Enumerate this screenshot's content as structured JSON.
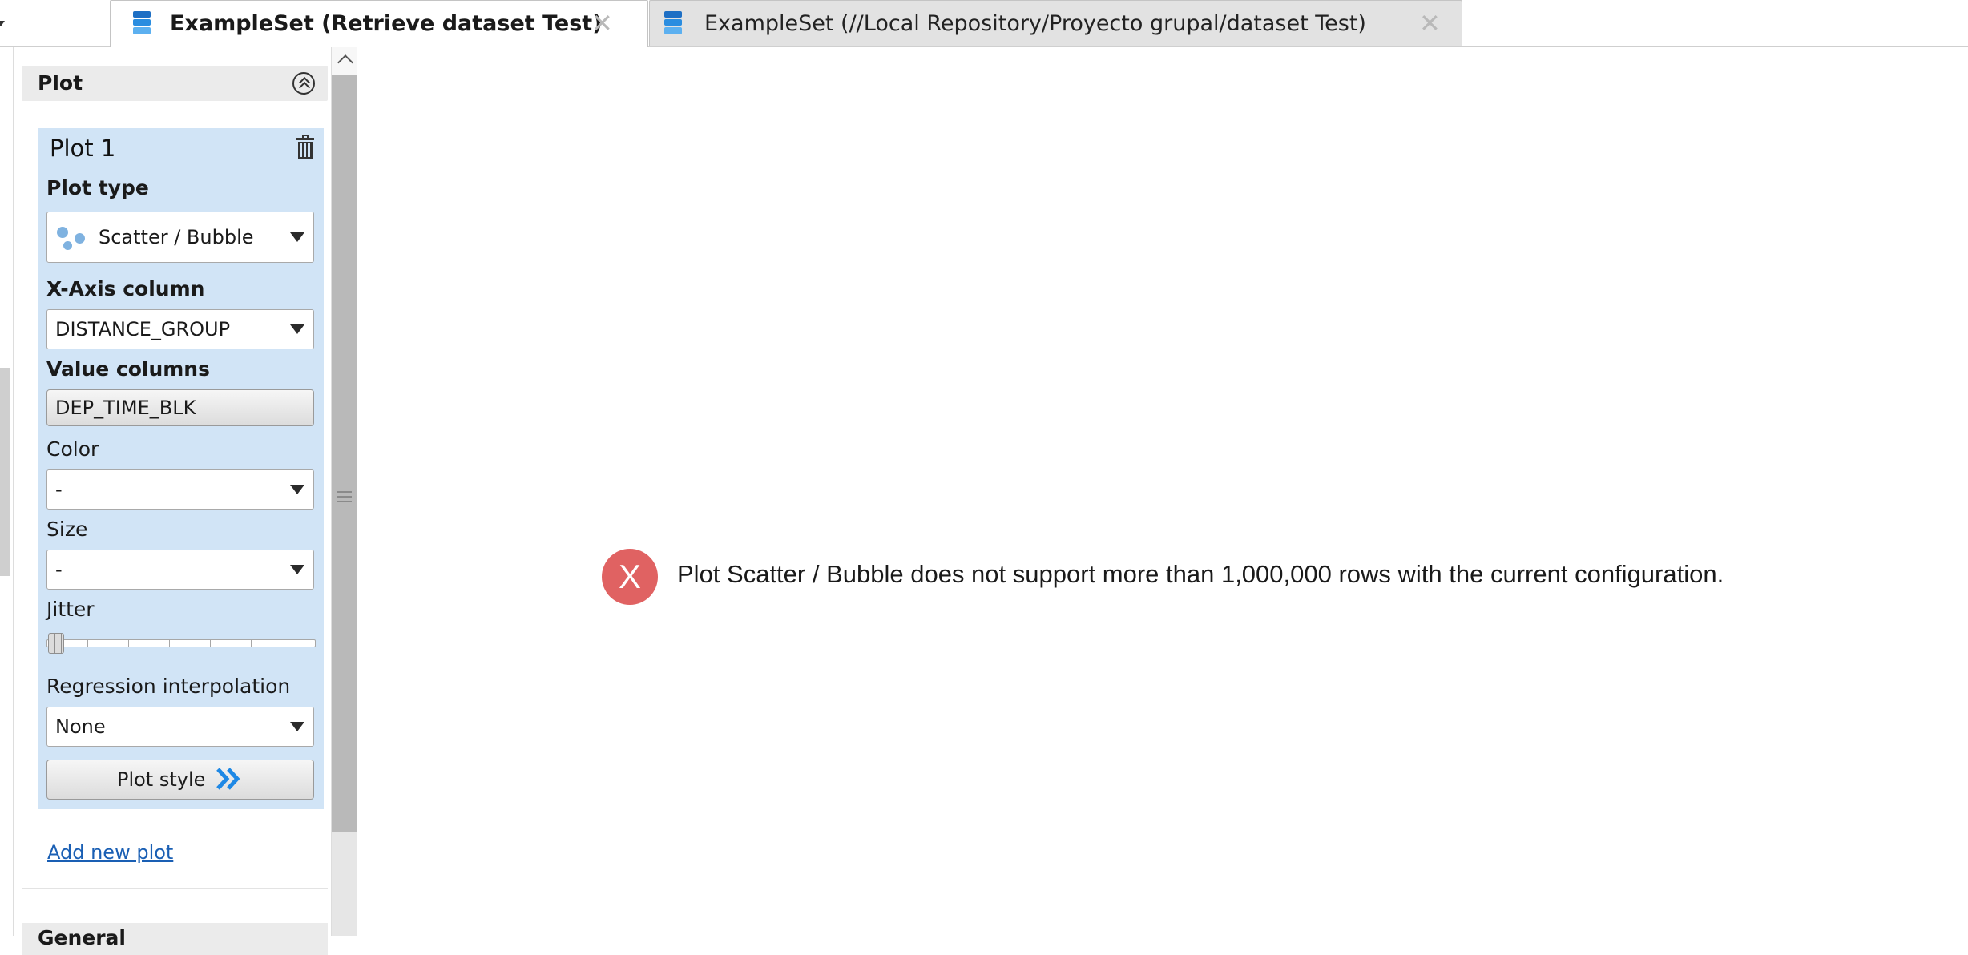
{
  "tabs": [
    {
      "label": "ExampleSet (Retrieve dataset Test)",
      "active": true,
      "icon": "dataset-icon",
      "close": "✕"
    },
    {
      "label": "ExampleSet (//Local Repository/Proyecto grupal/dataset Test)",
      "active": false,
      "icon": "dataset-icon",
      "close": "✕"
    }
  ],
  "panel": {
    "section_title": "Plot",
    "plot": {
      "title": "Plot 1",
      "plot_type_label": "Plot type",
      "plot_type_value": "Scatter / Bubble",
      "x_axis_label": "X-Axis column",
      "x_axis_value": "DISTANCE_GROUP",
      "value_columns_label": "Value columns",
      "value_columns_value": "DEP_TIME_BLK",
      "color_label": "Color",
      "color_value": "-",
      "size_label": "Size",
      "size_value": "-",
      "jitter_label": "Jitter",
      "jitter_value": 0,
      "regression_label": "Regression interpolation",
      "regression_value": "None",
      "plot_style_label": "Plot style"
    },
    "add_plot_link": "Add new plot",
    "next_section_title": "General"
  },
  "main": {
    "error_icon_text": "X",
    "error_message": "Plot Scatter / Bubble does not support more than 1,000,000 rows with the current configuration."
  },
  "colors": {
    "plot_box_bg": "#d1e4f6",
    "error_red": "#e06262",
    "link_blue": "#1a5fb4",
    "icon_blue": "#1e88e5"
  }
}
